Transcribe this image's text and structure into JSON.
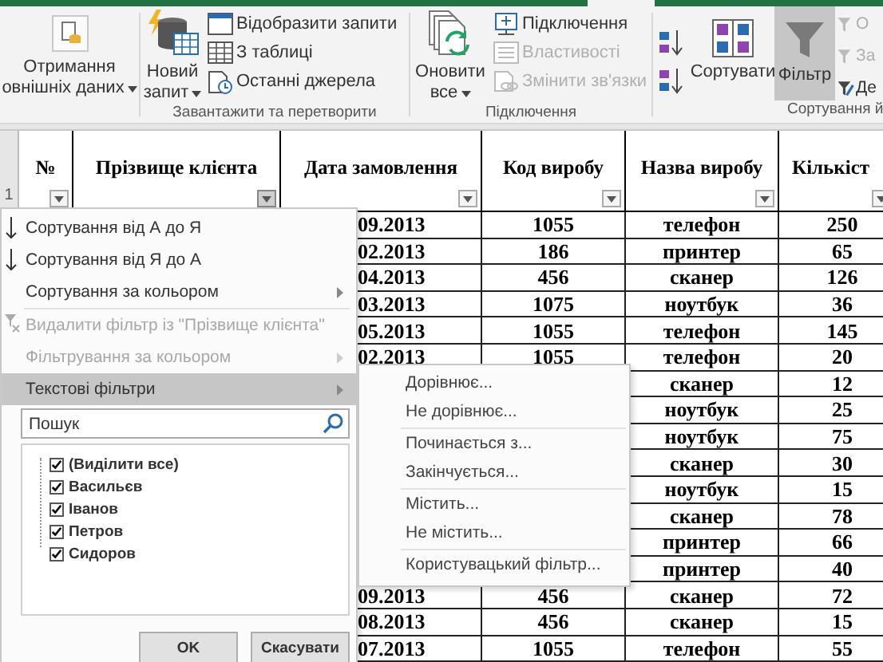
{
  "ribbon": {
    "get_data": {
      "lines": [
        "Отримання",
        "овнішніх даних"
      ]
    },
    "get_transform": {
      "new_query": {
        "lines": [
          "Новий",
          "запит"
        ]
      },
      "items": [
        {
          "label": "Відобразити запити",
          "disabled": false
        },
        {
          "label": "З таблиці",
          "disabled": false
        },
        {
          "label": "Останні джерела",
          "disabled": false
        }
      ],
      "label": "Завантажити та перетворити"
    },
    "connections": {
      "refresh": {
        "lines": [
          "Оновити",
          "все"
        ]
      },
      "items": [
        {
          "label": "Підключення",
          "disabled": false
        },
        {
          "label": "Властивості",
          "disabled": true
        },
        {
          "label": "Змінити зв'язки",
          "disabled": true
        }
      ],
      "label": "Підключення"
    },
    "sort_filter": {
      "sort": "Сортувати",
      "filter": {
        "label": "Фільтр",
        "selected": true
      },
      "items": [
        {
          "label": "О",
          "disabled": true
        },
        {
          "label": "За",
          "disabled": true
        },
        {
          "label": "Де",
          "disabled": false
        }
      ],
      "label": "Сортування й"
    }
  },
  "sheet": {
    "row_number": "1",
    "columns": [
      {
        "title": "№",
        "filter_pressed": false
      },
      {
        "title": "Прізвище клієнта",
        "filter_pressed": true
      },
      {
        "title": "Дата замовлення",
        "filter_pressed": false
      },
      {
        "title": "Код виробу",
        "filter_pressed": false
      },
      {
        "title": "Назва виробу",
        "filter_pressed": false
      },
      {
        "title": "Кількіст",
        "filter_pressed": false
      }
    ],
    "rows": [
      {
        "date": "09.2013",
        "code": "1055",
        "name": "телефон",
        "qty": "250"
      },
      {
        "date": "02.2013",
        "code": "186",
        "name": "принтер",
        "qty": "65"
      },
      {
        "date": "04.2013",
        "code": "456",
        "name": "сканер",
        "qty": "126"
      },
      {
        "date": "03.2013",
        "code": "1075",
        "name": "ноутбук",
        "qty": "36"
      },
      {
        "date": "05.2013",
        "code": "1055",
        "name": "телефон",
        "qty": "145"
      },
      {
        "date": "02.2013",
        "code": "1055",
        "name": "телефон",
        "qty": "20"
      },
      {
        "name": "сканер",
        "qty": "12"
      },
      {
        "name": "ноутбук",
        "qty": "25"
      },
      {
        "name": "ноутбук",
        "qty": "75"
      },
      {
        "name": "сканер",
        "qty": "30"
      },
      {
        "name": "ноутбук",
        "qty": "15"
      },
      {
        "name": "сканер",
        "qty": "78"
      },
      {
        "name": "принтер",
        "qty": "66"
      },
      {
        "name": "принтер",
        "qty": "40"
      },
      {
        "date": "09.2013",
        "code": "456",
        "name": "сканер",
        "qty": "72"
      },
      {
        "date": "08.2013",
        "code": "456",
        "name": "сканер",
        "qty": "15"
      },
      {
        "date": "07.2013",
        "code": "1055",
        "name": "телефон",
        "qty": "55"
      }
    ]
  },
  "filter_menu": {
    "groups": [
      [
        {
          "kind": "sort",
          "label": "Сортування від А до Я",
          "disabled": false,
          "submenu": false,
          "highlighted": false
        },
        {
          "kind": "sort",
          "label": "Сортування від Я до А",
          "disabled": false,
          "submenu": false,
          "highlighted": false
        },
        {
          "kind": "plain",
          "label": "Сортування за кольором",
          "disabled": false,
          "submenu": true,
          "highlighted": false
        }
      ],
      [
        {
          "kind": "clear",
          "label": "Видалити фільтр із \"Прізвище клієнта\"",
          "disabled": true,
          "submenu": false,
          "highlighted": false
        },
        {
          "kind": "plain",
          "label": "Фільтрування за кольором",
          "disabled": true,
          "submenu": true,
          "highlighted": false
        },
        {
          "kind": "plain",
          "label": "Текстові фільтри",
          "disabled": false,
          "submenu": true,
          "highlighted": true
        }
      ]
    ],
    "search": {
      "placeholder": "Пошук"
    },
    "values": [
      {
        "label": "(Виділити все)",
        "checked": true
      },
      {
        "label": "Васильєв",
        "checked": true
      },
      {
        "label": "Іванов",
        "checked": true
      },
      {
        "label": "Петров",
        "checked": true
      },
      {
        "label": "Сидоров",
        "checked": true
      }
    ],
    "buttons": [
      "OK",
      "Скасувати"
    ]
  },
  "text_filters_menu": {
    "groups": [
      [
        "Дорівнює...",
        "Не дорівнює..."
      ],
      [
        "Починається з...",
        "Закінчується..."
      ],
      [
        "Містить...",
        "Не містить..."
      ],
      [
        "Користувацький фільтр..."
      ]
    ]
  }
}
